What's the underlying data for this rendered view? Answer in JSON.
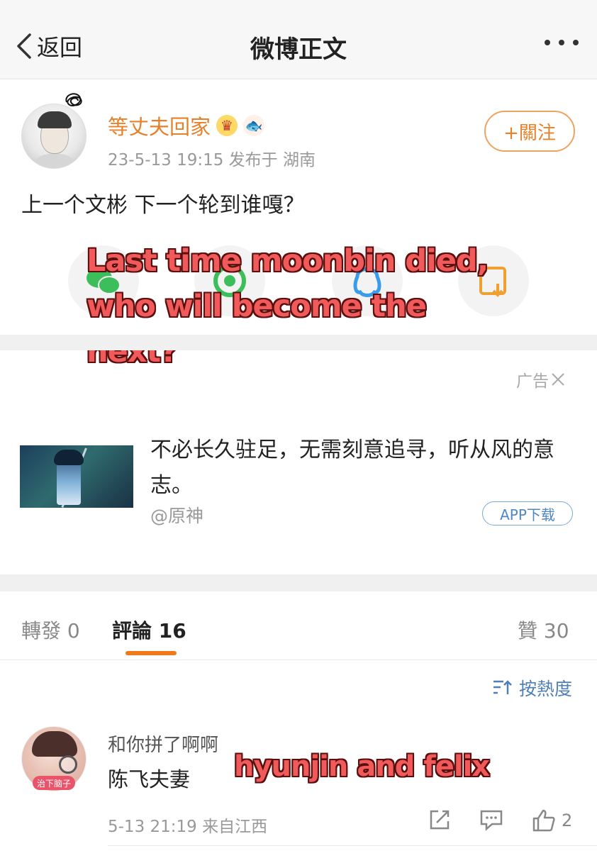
{
  "nav": {
    "back_label": "返回",
    "title": "微博正文"
  },
  "post": {
    "username": "等丈夫回家",
    "meta": "23-5-13 19:15  发布于 湖南",
    "follow_label": "+關注",
    "text": "上一个文彬 下一个轮到谁嘎？",
    "overlay_lines": [
      "Last time moonbin died,",
      "who will become the",
      "next?"
    ]
  },
  "share_icons": [
    {
      "icon": "wechat-icon",
      "color": "#3cbf5a"
    },
    {
      "icon": "moments-icon",
      "color": "#3cbf5a"
    },
    {
      "icon": "qq-icon",
      "color": "#3a9be8"
    },
    {
      "icon": "save-image-icon",
      "color": "#f0a030"
    }
  ],
  "ad": {
    "label": "广告",
    "text": "不必长久驻足，无需刻意追寻，听从风的意志。",
    "source": "@原神",
    "button": "APP下载"
  },
  "tabs": {
    "reposts": "轉發 0",
    "comments": "評論 16",
    "likes": "贊 30"
  },
  "sort": {
    "label": "按熱度"
  },
  "comment": {
    "avatar_tag": "治下脑子",
    "nickname": "和你拼了啊啊",
    "text": "陈飞夫妻",
    "overlay": "hyunjin and felix",
    "meta": "5-13 21:19  来自江西",
    "like_count": "2"
  },
  "colors": {
    "accent_orange": "#e8802a",
    "link_blue": "#4f7fb6",
    "overlay_red": "#f05a5a"
  }
}
